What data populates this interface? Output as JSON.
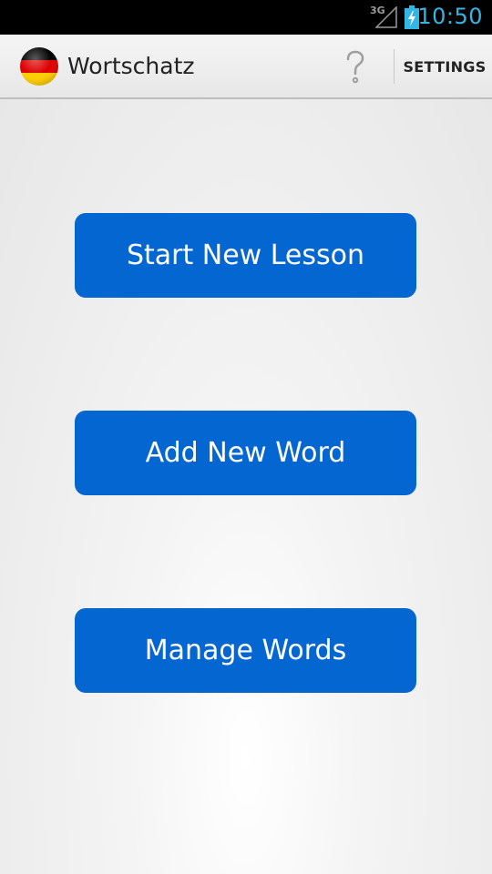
{
  "status_bar": {
    "network": "3G",
    "time": "10:50",
    "icons": [
      "signal-icon",
      "battery-charging-icon"
    ]
  },
  "action_bar": {
    "title": "Wortschatz",
    "app_icon": "german-flag-icon",
    "help_icon": "help-question-icon",
    "settings_label": "SETTINGS"
  },
  "buttons": [
    {
      "label": "Start New Lesson"
    },
    {
      "label": "Add New Word"
    },
    {
      "label": "Manage Words"
    }
  ],
  "colors": {
    "button_bg": "#0466d0",
    "status_time": "#33b5e5",
    "status_bar_bg": "#000000",
    "flag_black": "#000000",
    "flag_red": "#dd0000",
    "flag_gold": "#ffce00"
  }
}
